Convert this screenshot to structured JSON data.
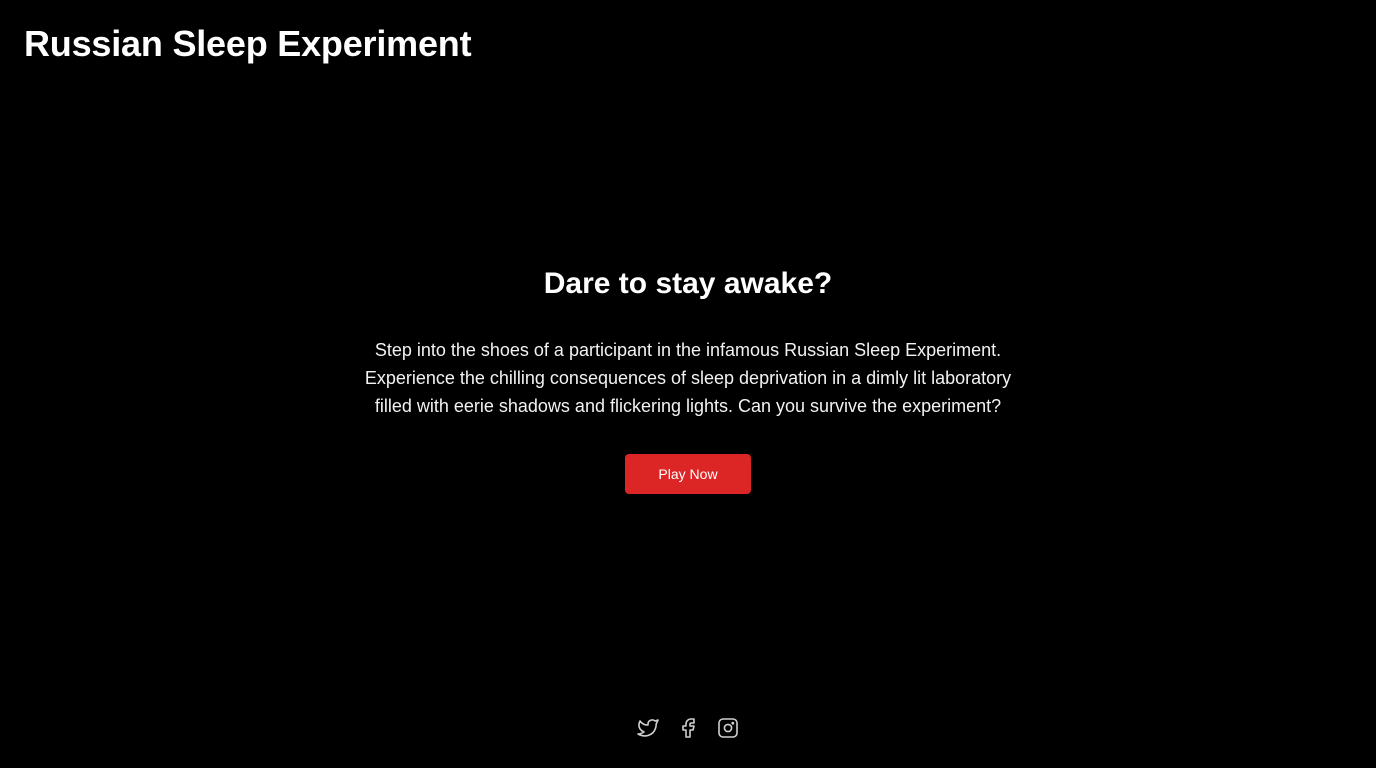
{
  "header": {
    "title": "Russian Sleep Experiment"
  },
  "hero": {
    "heading": "Dare to stay awake?",
    "description": "Step into the shoes of a participant in the infamous Russian Sleep Experiment. Experience the chilling consequences of sleep deprivation in a dimly lit laboratory filled with eerie shadows and flickering lights. Can you survive the experiment?",
    "cta_label": "Play Now"
  },
  "footer": {
    "social_icons": [
      "twitter-icon",
      "facebook-icon",
      "instagram-icon"
    ]
  },
  "colors": {
    "background": "#000000",
    "text": "#ffffff",
    "accent": "#dc2626",
    "icon": "#cfcfcf"
  }
}
